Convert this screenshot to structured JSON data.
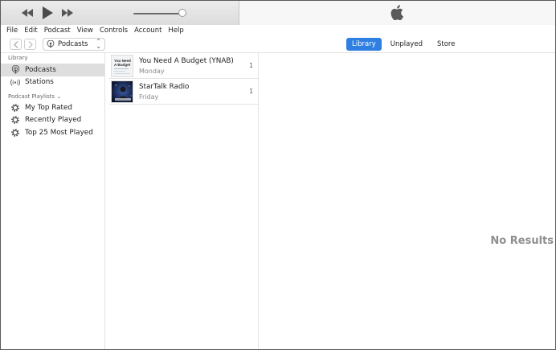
{
  "player": {
    "rewind_icon": "rewind-icon",
    "play_icon": "play-icon",
    "forward_icon": "fast-forward-icon",
    "volume_level": 0.9,
    "apple_icon": "apple-logo-icon"
  },
  "menubar": {
    "items": [
      "File",
      "Edit",
      "Podcast",
      "View",
      "Controls",
      "Account",
      "Help"
    ]
  },
  "nav": {
    "media_selector_label": "Podcasts",
    "tabs": [
      {
        "label": "Library",
        "active": true
      },
      {
        "label": "Unplayed",
        "active": false
      },
      {
        "label": "Store",
        "active": false
      }
    ]
  },
  "sidebar": {
    "library_header": "Library",
    "library_items": [
      {
        "label": "Podcasts",
        "icon": "podcast-icon",
        "selected": true
      },
      {
        "label": "Stations",
        "icon": "radio-waves-icon",
        "selected": false
      }
    ],
    "playlists_header": "Podcast Playlists ⌄",
    "playlists": [
      {
        "label": "My Top Rated",
        "icon": "gear-icon"
      },
      {
        "label": "Recently Played",
        "icon": "gear-icon"
      },
      {
        "label": "Top 25 Most Played",
        "icon": "gear-icon"
      }
    ]
  },
  "podcasts": [
    {
      "title": "You Need A Budget (YNAB)",
      "subtitle": "Monday",
      "count": "1",
      "thumb_text": "You Need A Budget"
    },
    {
      "title": "StarTalk Radio",
      "subtitle": "Friday",
      "count": "1"
    }
  ],
  "detail": {
    "empty_text": "No Results"
  },
  "colors": {
    "accent": "#2f7fe3",
    "selected_bg": "#dedede"
  }
}
